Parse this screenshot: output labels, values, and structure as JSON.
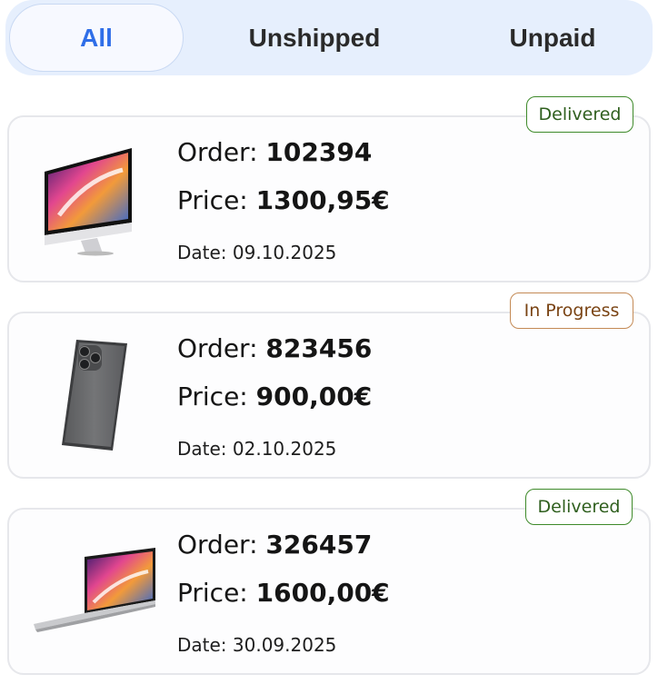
{
  "tabs": [
    {
      "label": "All"
    },
    {
      "label": "Unshipped"
    },
    {
      "label": "Unpaid"
    }
  ],
  "orders": [
    {
      "order_label": "Order: ",
      "order_number": "102394",
      "price_label": "Price: ",
      "price": "1300,95€",
      "date": "Date: 09.10.2025",
      "status": "Delivered",
      "product_icon": "imac-icon"
    },
    {
      "order_label": "Order: ",
      "order_number": "823456",
      "price_label": "Price: ",
      "price": "900,00€",
      "date": "Date: 02.10.2025",
      "status": "In Progress",
      "product_icon": "iphone-icon"
    },
    {
      "order_label": "Order: ",
      "order_number": "326457",
      "price_label": "Price: ",
      "price": "1600,00€",
      "date": "Date: 30.09.2025",
      "status": "Delivered",
      "product_icon": "macbook-icon"
    }
  ],
  "colors": {
    "accent": "#2f6ee8",
    "tab_bar_bg": "#e6effd",
    "delivered": "#3e8a2a",
    "in_progress": "#c48a55"
  }
}
